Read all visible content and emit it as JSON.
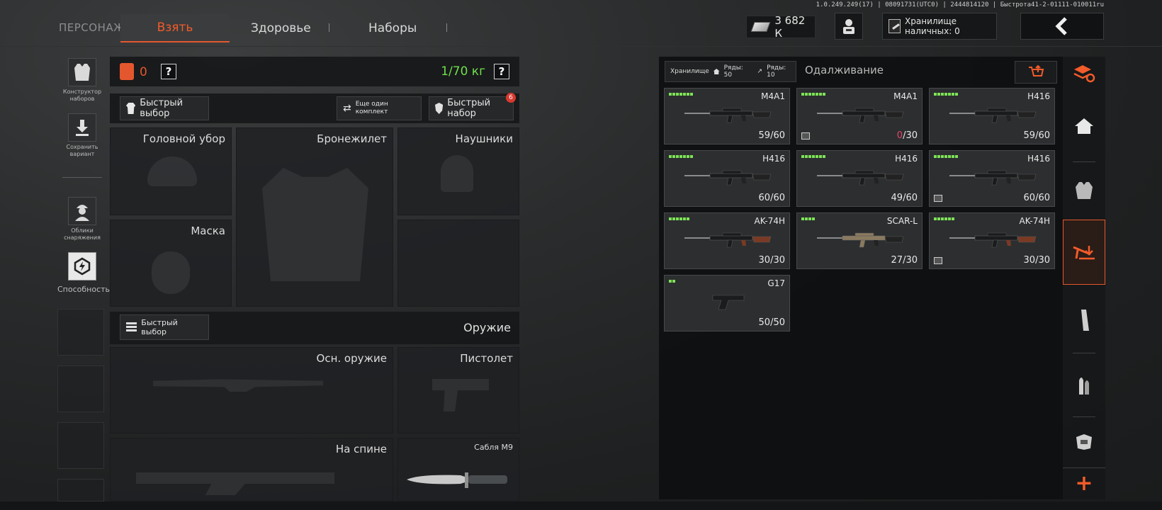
{
  "topbar": {
    "character_label": "ПЕРСОНАЖ",
    "tabs": [
      {
        "label": "Взять",
        "active": true
      },
      {
        "label": "Здоровье",
        "active": false
      },
      {
        "label": "Наборы",
        "active": false
      }
    ],
    "version": "1.0.249.249(17) | 08091731(UTC0) | 2444814120 | Быстрота41-2-01111-010011ru",
    "money": "3 682 К",
    "cash_storage_label": "Хранилище наличных: 0",
    "back_icon": "chevron-left-icon",
    "accent_color": "#e4572e"
  },
  "left_sidebar": {
    "items": [
      {
        "label": "Конструктор наборов",
        "icon": "vest-icon"
      },
      {
        "label": "Сохранить вариант",
        "icon": "download-icon"
      },
      {
        "label": "Облики снаряжения",
        "icon": "soldier-icon"
      },
      {
        "label": "Способность",
        "icon": "ability-icon"
      }
    ]
  },
  "loadout": {
    "backpack_count": "0",
    "weight": "1/70 кг",
    "help": "?",
    "quick_select": "Быстрый выбор",
    "another_set": "Еще один комплект",
    "quick_set": "Быстрый набор",
    "quick_set_badge": "6",
    "slots": {
      "helmet": "Головной убор",
      "vest": "Бронежилет",
      "headphones": "Наушники",
      "mask": "Маска",
      "primary": "Осн. оружие",
      "pistol": "Пистолет",
      "back": "На спине",
      "melee": "Сабля M9"
    },
    "weapons_quick_select": "Быстрый выбор",
    "weapons_title": "Оружие"
  },
  "storage": {
    "tab_label": "Хранилище",
    "rows_home": "Ряды: 50",
    "rows_other": "Ряды: 10",
    "second_tab": "Одалживание",
    "weapons": [
      {
        "name": "M4A1",
        "ammo_cur": "59",
        "ammo_max": "60",
        "pips": 7,
        "empty": false,
        "flag": false
      },
      {
        "name": "M4A1",
        "ammo_cur": "0",
        "ammo_max": "30",
        "pips": 7,
        "empty": true,
        "flag": true
      },
      {
        "name": "H416",
        "ammo_cur": "59",
        "ammo_max": "60",
        "pips": 7,
        "empty": false,
        "flag": false
      },
      {
        "name": "H416",
        "ammo_cur": "60",
        "ammo_max": "60",
        "pips": 7,
        "empty": false,
        "flag": false
      },
      {
        "name": "H416",
        "ammo_cur": "49",
        "ammo_max": "60",
        "pips": 7,
        "empty": false,
        "flag": false
      },
      {
        "name": "H416",
        "ammo_cur": "60",
        "ammo_max": "60",
        "pips": 7,
        "empty": false,
        "flag": true
      },
      {
        "name": "AK-74H",
        "ammo_cur": "30",
        "ammo_max": "30",
        "pips": 6,
        "empty": false,
        "flag": false
      },
      {
        "name": "SCAR-L",
        "ammo_cur": "27",
        "ammo_max": "30",
        "pips": 4,
        "empty": false,
        "flag": false
      },
      {
        "name": "AK-74H",
        "ammo_cur": "30",
        "ammo_max": "30",
        "pips": 6,
        "empty": false,
        "flag": true
      },
      {
        "name": "G17",
        "ammo_cur": "50",
        "ammo_max": "50",
        "pips": 2,
        "empty": false,
        "flag": false
      }
    ]
  },
  "right_rail": {
    "items": [
      "stack-refresh-icon",
      "home-icon",
      "vest-icon",
      "weapon-download-icon",
      "magazine-icon",
      "ammo-icon",
      "armor-icon",
      "plus-icon"
    ],
    "active_index": 3
  }
}
